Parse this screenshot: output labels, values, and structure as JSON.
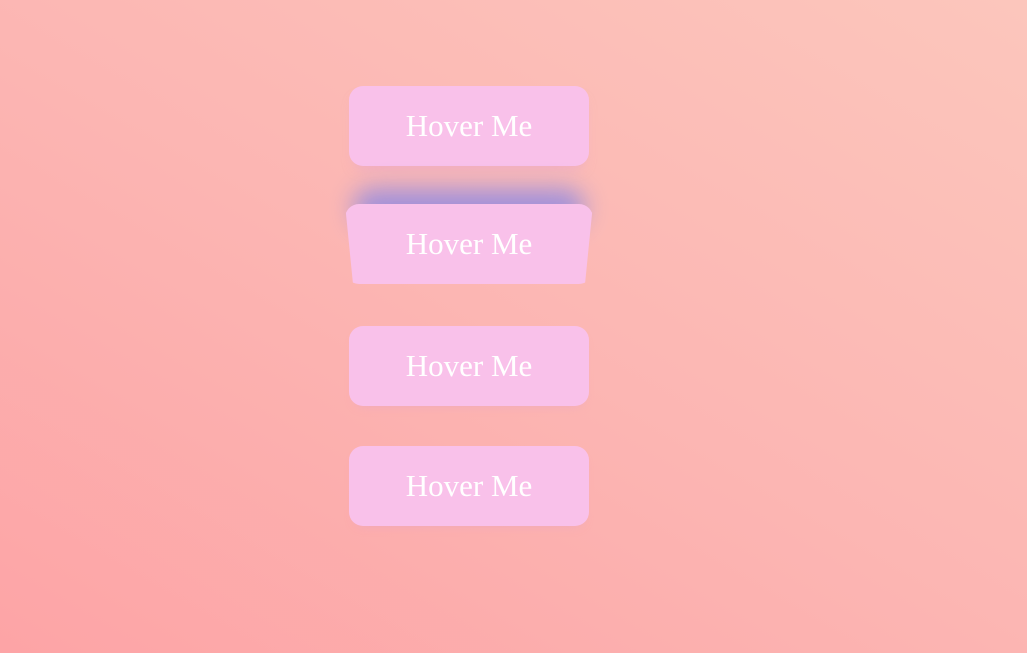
{
  "buttons": [
    {
      "label": "Hover Me"
    },
    {
      "label": "Hover Me"
    },
    {
      "label": "Hover Me"
    },
    {
      "label": "Hover Me"
    }
  ],
  "colors": {
    "background_start": "#fda4a6",
    "background_end": "#fcc6bc",
    "button_fill": "#f9c1ea",
    "button_text": "#ffffff",
    "hover_glow": "#9d8fdc"
  }
}
